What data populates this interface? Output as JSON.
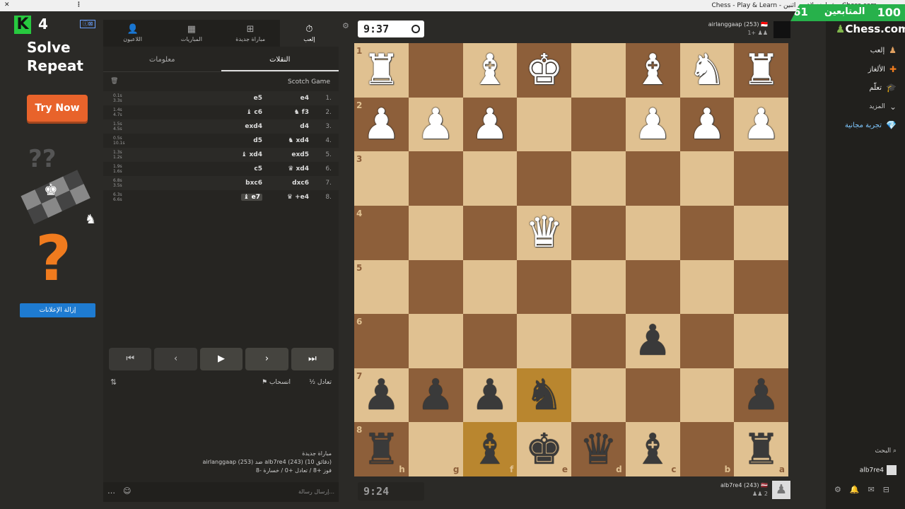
{
  "window": {
    "title": "Chess - Play & Learn - شطرنج لاعبين اثنين - Chess.com"
  },
  "ad": {
    "brand_letter": "K",
    "brand_number": "4",
    "badge": "ⓘ⊠",
    "headline_1": "Solve",
    "headline_2": "Repeat",
    "cta": "Try Now",
    "remove_ads": "إزالة الإعلانات"
  },
  "panel": {
    "nav_tabs": [
      {
        "label": "اللاعبون",
        "icon": "players-icon",
        "glyph": "👤"
      },
      {
        "label": "المباريات",
        "icon": "games-icon",
        "glyph": "▦"
      },
      {
        "label": "مباراة جديدة",
        "icon": "new-game-icon",
        "glyph": "⊞"
      },
      {
        "label": "إلعب",
        "icon": "clock-icon",
        "glyph": "⏱"
      }
    ],
    "sub_tabs": [
      {
        "label": "معلومات"
      },
      {
        "label": "النقلات"
      }
    ],
    "opening_name": "Scotch Game",
    "moves": [
      {
        "n": "1.",
        "white": "e4",
        "black": "e5",
        "wt": "0.1s",
        "bt": "3.3s"
      },
      {
        "n": "2.",
        "white": "♞ f3",
        "black": "♝ c6",
        "wt": "1.4s",
        "bt": "4.7s"
      },
      {
        "n": "3.",
        "white": "d4",
        "black": "exd4",
        "wt": "1.5s",
        "bt": "4.5s"
      },
      {
        "n": "4.",
        "white": "♞ xd4",
        "black": "d5",
        "wt": "0.5s",
        "bt": "10.1s"
      },
      {
        "n": "5.",
        "white": "exd5",
        "black": "♝ xd4",
        "wt": "1.3s",
        "bt": "1.2s"
      },
      {
        "n": "6.",
        "white": "♛ xd4",
        "black": "c5",
        "wt": "1.9s",
        "bt": "1.6s"
      },
      {
        "n": "7.",
        "white": "dxc6",
        "black": "bxc6",
        "wt": "6.8s",
        "bt": "3.5s"
      },
      {
        "n": "8.",
        "white": "♛ +e4",
        "black": "♝ e7",
        "wt": "6.3s",
        "bt": "6.6s"
      }
    ],
    "controls": [
      "⏮",
      "‹",
      "▶",
      "›",
      "⏭"
    ],
    "draw_label": "½ تعادل",
    "resign_label": "⚑ انسحاب",
    "info_line1": "مباراة جديدة",
    "info_line2": "airlanggaap (253) ضد alb7re4 (243) (10 دقائق)",
    "info_line3": "فوز +8 / تعادل +0 / خسارة -8",
    "chat_placeholder": "إرسال رسالة..."
  },
  "top_player": {
    "name": "airlanggaap (253) 🇮🇩",
    "sub": "1+ ♟♟",
    "clock": "9:37"
  },
  "bottom_player": {
    "name": "alb7re4 (243) 🇱🇻",
    "sub": "♟♟ 2",
    "clock": "9:24"
  },
  "board": {
    "ranks": [
      "1",
      "2",
      "3",
      "4",
      "5",
      "6",
      "7",
      "8"
    ],
    "files": [
      "h",
      "g",
      "f",
      "e",
      "d",
      "c",
      "b",
      "a"
    ],
    "rows": [
      [
        "wr",
        "",
        "wb",
        "wk",
        "",
        "wb",
        "wn",
        "wr"
      ],
      [
        "wp",
        "wp",
        "wp",
        "",
        "",
        "wp",
        "wp",
        "wp"
      ],
      [
        "",
        "",
        "",
        "",
        "",
        "",
        "",
        ""
      ],
      [
        "",
        "",
        "",
        "wq",
        "",
        "",
        "",
        ""
      ],
      [
        "",
        "",
        "",
        "",
        "",
        "",
        "",
        ""
      ],
      [
        "",
        "",
        "",
        "",
        "",
        "bp",
        "",
        ""
      ],
      [
        "bp",
        "bp",
        "bp",
        "bn",
        "",
        "",
        "",
        "bp"
      ],
      [
        "br",
        "",
        "bb",
        "bk",
        "bq",
        "bb",
        "",
        "br"
      ]
    ],
    "highlights": [
      "7-3",
      "8-2"
    ]
  },
  "right": {
    "followers_count": "61",
    "followers_label": "المتابعين",
    "score": "100",
    "brand": "Chess.com",
    "nav": [
      {
        "label": "إلعب",
        "icon": "play-icon",
        "glyph": "♟"
      },
      {
        "label": "الألغاز",
        "icon": "puzzle-icon",
        "glyph": "✚"
      },
      {
        "label": "تعلّم",
        "icon": "learn-icon",
        "glyph": "🎓"
      },
      {
        "label": "المزيد",
        "icon": "more-icon",
        "glyph": "⌄"
      },
      {
        "label": "تجربة مجانية",
        "icon": "diamond-icon",
        "glyph": "💎"
      }
    ],
    "search_label": "البحث",
    "username": "alb7re4"
  },
  "colors": {
    "light": "#e0c191",
    "dark": "#8d5f3a",
    "highlight": "#d9a94c",
    "accent": "#81b64c"
  }
}
